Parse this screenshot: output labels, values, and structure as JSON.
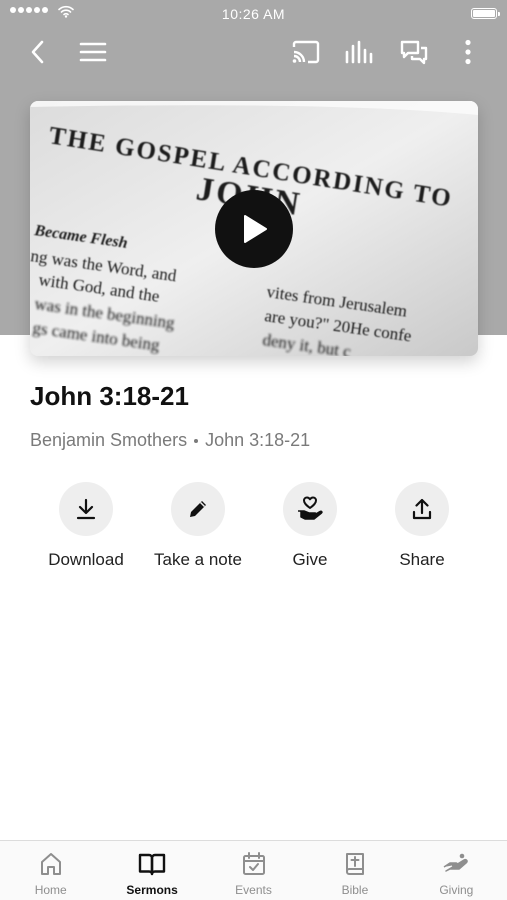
{
  "status_bar": {
    "time": "10:26 AM"
  },
  "video": {
    "page_text": {
      "heading_line1": "THE GOSPEL ACCORDING TO",
      "heading_line2": "JOHN",
      "side_title": "Became Flesh",
      "left_lines": [
        "ng was the Word, and",
        "with God, and the",
        "was in the beginning",
        "gs came into being"
      ],
      "right_lines": [
        "vites from Jerusalem",
        "are you?\" 20He confe",
        "deny it, but c"
      ]
    }
  },
  "sermon": {
    "title": "John 3:18-21",
    "speaker": "Benjamin Smothers",
    "passage": "John 3:18-21"
  },
  "actions": [
    {
      "label": "Download",
      "icon": "download-icon"
    },
    {
      "label": "Take a note",
      "icon": "pencil-icon"
    },
    {
      "label": "Give",
      "icon": "give-heart-hand-icon"
    },
    {
      "label": "Share",
      "icon": "share-icon"
    }
  ],
  "tabs": [
    {
      "label": "Home",
      "icon": "home-icon",
      "active": false
    },
    {
      "label": "Sermons",
      "icon": "book-open-icon",
      "active": true
    },
    {
      "label": "Events",
      "icon": "calendar-icon",
      "active": false
    },
    {
      "label": "Bible",
      "icon": "bible-icon",
      "active": false
    },
    {
      "label": "Giving",
      "icon": "giving-hand-icon",
      "active": false
    }
  ],
  "colors": {
    "active_tab": "#111111",
    "inactive_tab": "#8e8e8e",
    "hero_background": "#a9a9a9"
  }
}
